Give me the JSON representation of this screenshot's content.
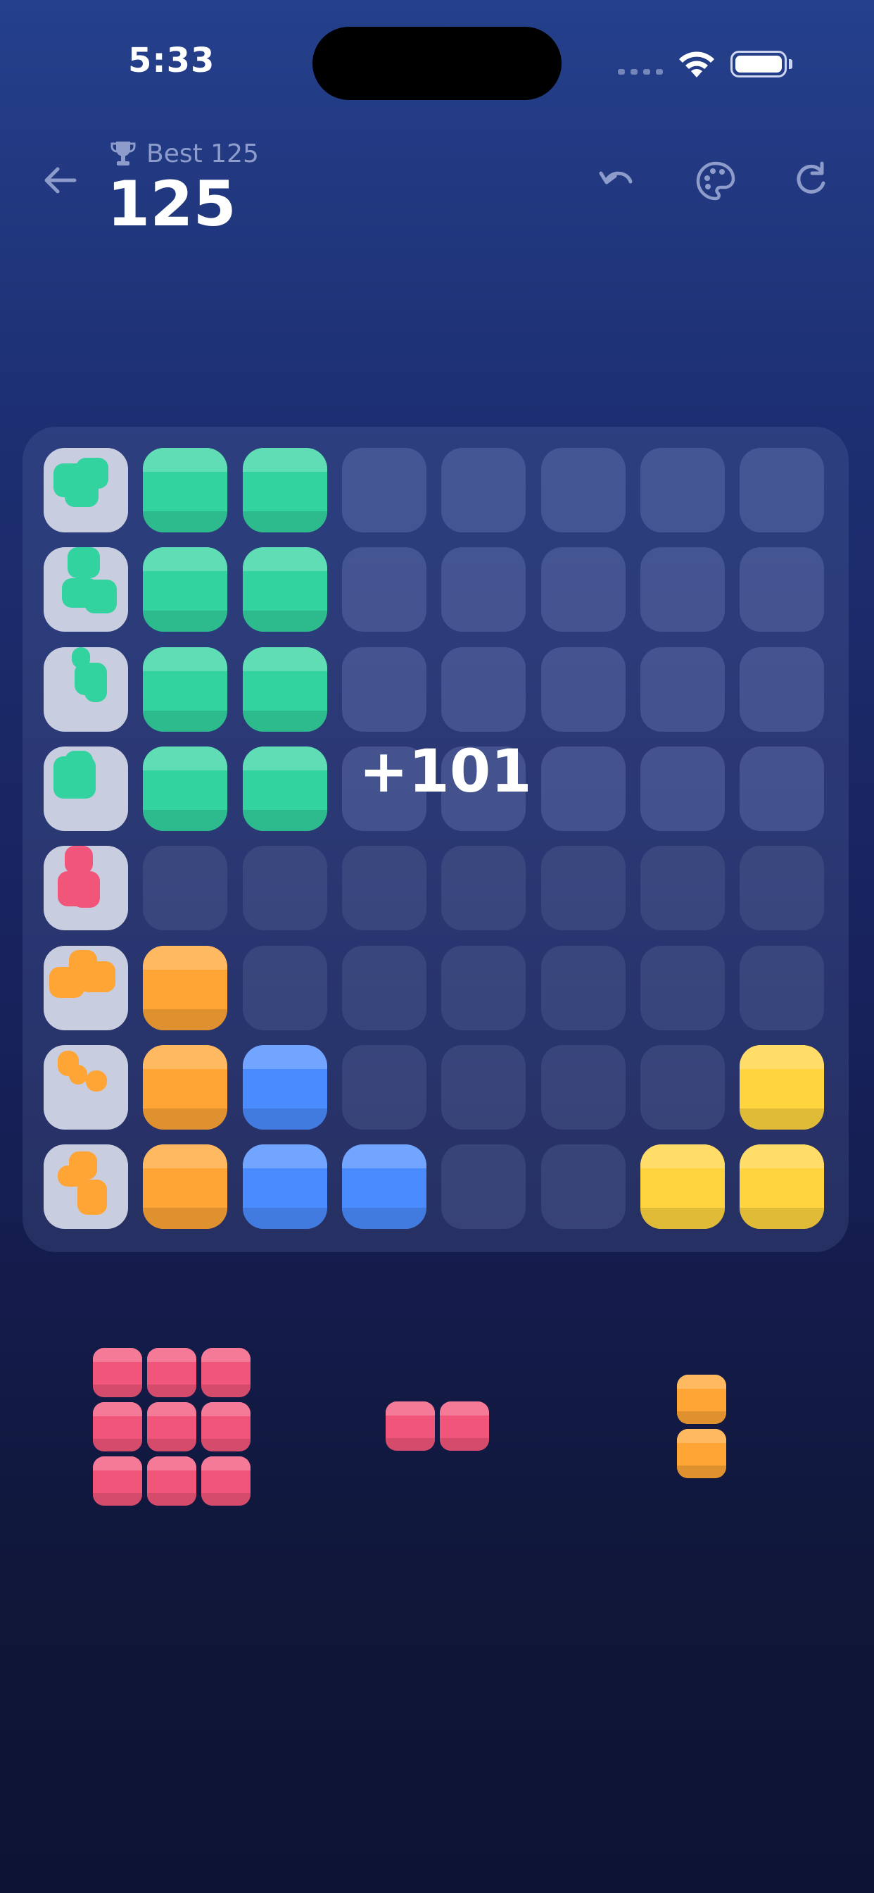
{
  "status_bar": {
    "time": "5:33"
  },
  "header": {
    "best_label": "Best 125",
    "score": "125",
    "back_icon": "back-arrow-icon",
    "undo_icon": "undo-icon",
    "theme_icon": "palette-icon",
    "restart_icon": "restart-icon"
  },
  "colors": {
    "green": "#33d3a0",
    "orange": "#ffa535",
    "blue": "#4a8cff",
    "yellow": "#ffd43e",
    "pink": "#f2557a",
    "grey": "#c9cde0"
  },
  "board": {
    "float_score": "+101",
    "rows": [
      [
        "grey-green",
        "green",
        "green",
        "empty",
        "empty",
        "empty",
        "empty",
        "empty"
      ],
      [
        "grey-green",
        "green",
        "green",
        "empty",
        "empty",
        "empty",
        "empty",
        "empty"
      ],
      [
        "grey-green",
        "green",
        "green",
        "empty",
        "empty",
        "empty",
        "empty",
        "empty"
      ],
      [
        "grey-green",
        "green",
        "green",
        "empty",
        "empty",
        "empty",
        "empty",
        "empty"
      ],
      [
        "grey-pink",
        "empty",
        "empty",
        "empty",
        "empty",
        "empty",
        "empty",
        "empty"
      ],
      [
        "grey-orange",
        "orange",
        "empty",
        "empty",
        "empty",
        "empty",
        "empty",
        "empty"
      ],
      [
        "grey-orange",
        "orange",
        "blue",
        "empty",
        "empty",
        "empty",
        "empty",
        "yellow"
      ],
      [
        "grey-orange",
        "orange",
        "blue",
        "blue",
        "empty",
        "empty",
        "yellow",
        "yellow"
      ]
    ]
  },
  "tray": [
    {
      "name": "piece-square-3x3",
      "color": "pink",
      "cells": [
        [
          0,
          0
        ],
        [
          1,
          0
        ],
        [
          2,
          0
        ],
        [
          0,
          1
        ],
        [
          1,
          1
        ],
        [
          2,
          1
        ],
        [
          0,
          2
        ],
        [
          1,
          2
        ],
        [
          2,
          2
        ]
      ]
    },
    {
      "name": "piece-bar-2",
      "color": "pink",
      "cells": [
        [
          0,
          0
        ],
        [
          1,
          0
        ]
      ]
    },
    {
      "name": "piece-vertical-2",
      "color": "orange",
      "cells": [
        [
          0,
          0
        ],
        [
          0,
          1
        ]
      ]
    }
  ]
}
